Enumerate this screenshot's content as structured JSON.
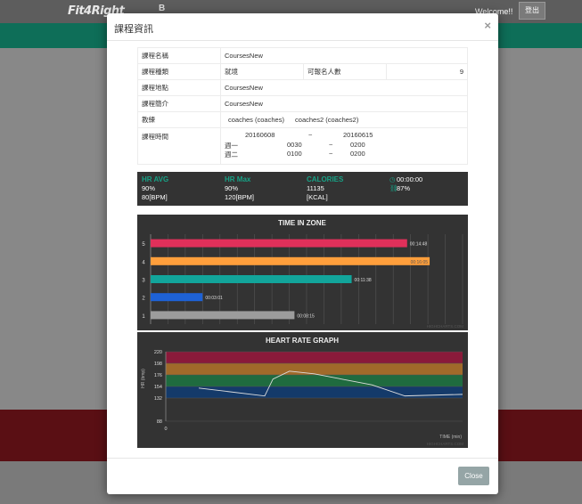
{
  "background": {
    "logo": "Fit4Right",
    "logo2": "B",
    "welcome": "Welcome!!",
    "logout_label": "登出"
  },
  "modal": {
    "title": "課程資訊",
    "close_x": "×",
    "close_button": "Close"
  },
  "info": {
    "course_name_label": "課程名稱",
    "course_name": "CoursesNew",
    "course_type_label": "課程種類",
    "course_type": "就境",
    "capacity_label": "可報名人數",
    "capacity": "9",
    "location_label": "課程地點",
    "location": "CoursesNew",
    "intro_label": "課程簡介",
    "intro": "CoursesNew",
    "coach_label": "教練",
    "coach1": "coaches (coaches)",
    "coach2": "coaches2 (coaches2)",
    "time_label": "課程時間",
    "date_start": "20160608",
    "date_sep": "~",
    "date_end": "20160615",
    "slots": [
      {
        "day": "週一",
        "start": "0030",
        "sep": "~",
        "end": "0200"
      },
      {
        "day": "週二",
        "start": "0100",
        "sep": "~",
        "end": "0200"
      }
    ]
  },
  "stats": {
    "hr_avg_label": "HR AVG",
    "hr_avg_pct": "90%",
    "hr_avg_bpm": "80[BPM]",
    "hr_max_label": "HR Max",
    "hr_max_pct": "90%",
    "hr_max_bpm": "120[BPM]",
    "calories_label": "CALORIES",
    "calories_value": "11135",
    "calories_unit": "[KCAL]",
    "time_value": "00:00:00",
    "pct_value": "87%",
    "accent": "#17a185"
  },
  "chart_data": [
    {
      "type": "bar",
      "title": "TIME IN ZONE",
      "orientation": "horizontal",
      "categories": [
        "5",
        "4",
        "3",
        "2",
        "1"
      ],
      "values_min": [
        14.8,
        16.1,
        11.6,
        3.0,
        8.3
      ],
      "value_labels": [
        "00:14:48",
        "00:16:05",
        "00:11:38",
        "00:03:01",
        "00:08:15"
      ],
      "colors": [
        "#e0305a",
        "#ff9f3c",
        "#12a59b",
        "#1e62d6",
        "#9c9c9c"
      ],
      "xlim": [
        0,
        18
      ],
      "grid": true,
      "watermark": "HIGHCHARTS.COM"
    },
    {
      "type": "line",
      "title": "HEART RATE GRAPH",
      "ylabel": "HR (bmp)",
      "xlabel": "TIME (min)",
      "yticks": [
        "220",
        "198",
        "176",
        "154",
        "132",
        "88"
      ],
      "ylim": [
        88,
        220
      ],
      "xticks": [
        "0"
      ],
      "xlim": [
        0,
        36
      ],
      "zone_colors": [
        "#8a1a3a",
        "#a06a2a",
        "#1f6b3f",
        "#143a6a"
      ],
      "zone_bounds": [
        [
          198,
          220
        ],
        [
          176,
          198
        ],
        [
          154,
          176
        ],
        [
          132,
          154
        ]
      ],
      "series": [
        {
          "x": [
            4,
            12,
            13,
            15,
            18,
            25,
            29,
            36
          ],
          "values": [
            151,
            136,
            168,
            183,
            178,
            157,
            136,
            139
          ],
          "color": "#dddddd"
        }
      ],
      "watermark": "HIGHCHARTS.COM"
    }
  ]
}
